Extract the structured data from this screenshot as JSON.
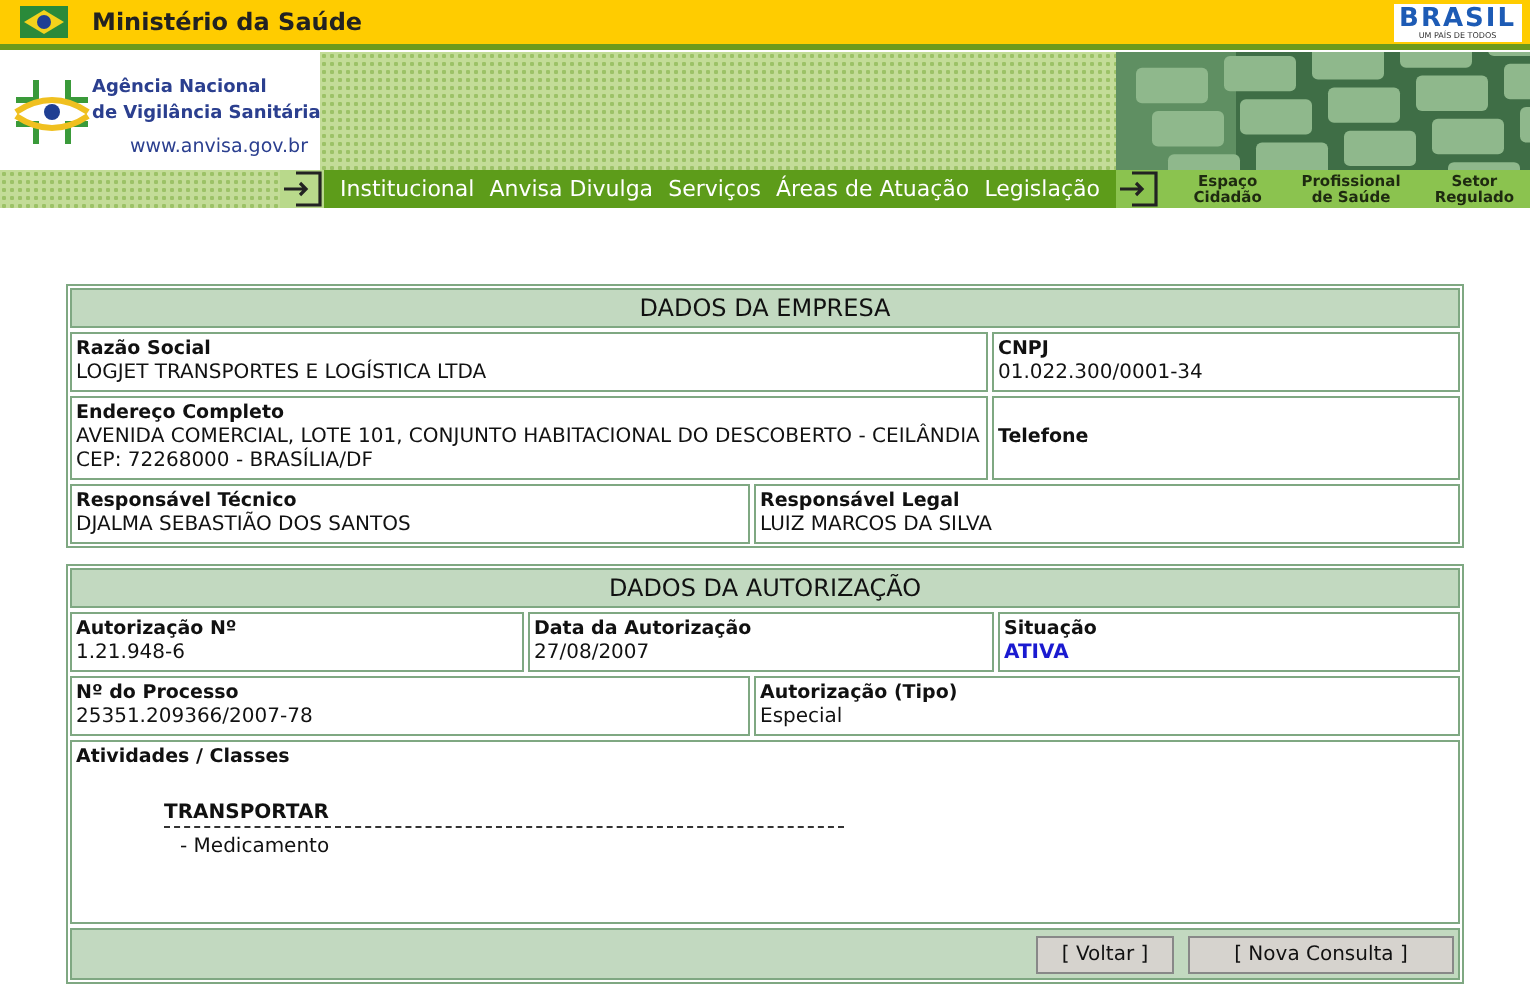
{
  "top_bar": {
    "title": "Ministério da Saúde",
    "brand": "BRASIL",
    "brand_tagline": "UM PAÍS DE TODOS"
  },
  "agency": {
    "name_lines": [
      "Agência Nacional",
      "de Vigilância Sanitária"
    ],
    "url": "www.anvisa.gov.br"
  },
  "nav": {
    "items": [
      "Institucional",
      "Anvisa Divulga",
      "Serviços",
      "Áreas de Atuação",
      "Legislação"
    ],
    "portals": [
      {
        "lines": [
          "Espaço",
          "Cidadão"
        ]
      },
      {
        "lines": [
          "Profissional",
          "de Saúde"
        ]
      },
      {
        "lines": [
          "Setor",
          "Regulado"
        ]
      }
    ]
  },
  "sections": [
    {
      "title": "DADOS DA EMPRESA",
      "rows": [
        [
          {
            "label": "Razão Social",
            "value_lines": [
              "LOGJET TRANSPORTES E LOGÍSTICA LTDA"
            ],
            "kind": "text"
          },
          {
            "label": "CNPJ",
            "value_lines": [
              "01.022.300/0001-34"
            ],
            "kind": "text"
          }
        ],
        [
          {
            "label": "Endereço Completo",
            "value_lines": [
              "AVENIDA COMERCIAL, LOTE 101, CONJUNTO HABITACIONAL DO DESCOBERTO - CEILÂNDIA",
              "CEP: 72268000 - BRASÍLIA/DF"
            ],
            "kind": "text"
          },
          {
            "label": "Telefone",
            "kind": "label_only"
          }
        ],
        [
          {
            "label": "Responsável Técnico",
            "value_lines": [
              "DJALMA SEBASTIÃO DOS SANTOS"
            ],
            "kind": "text"
          },
          {
            "label": "Responsável Legal",
            "value_lines": [
              "LUIZ MARCOS DA SILVA"
            ],
            "kind": "text"
          }
        ]
      ]
    },
    {
      "title": "DADOS DA AUTORIZAÇÃO",
      "rows": [
        [
          {
            "label": "Autorização Nº",
            "value_lines": [
              "1.21.948-6"
            ],
            "kind": "text"
          },
          {
            "label": "Data da Autorização",
            "value_lines": [
              "27/08/2007"
            ],
            "kind": "text"
          },
          {
            "label": "Situação",
            "value_lines": [
              "ATIVA"
            ],
            "kind": "status"
          }
        ],
        [
          {
            "label": "Nº do Processo",
            "value_lines": [
              "25351.209366/2007-78"
            ],
            "kind": "text"
          },
          {
            "label": "Autorização (Tipo)",
            "value_lines": [
              "Especial"
            ],
            "kind": "text"
          }
        ]
      ],
      "activities": {
        "label": "Atividades / Classes",
        "groups": [
          {
            "title": "TRANSPORTAR",
            "items": [
              "- Medicamento"
            ]
          }
        ]
      },
      "buttons": [
        "[ Voltar ]",
        "[ Nova Consulta ]"
      ]
    }
  ]
}
